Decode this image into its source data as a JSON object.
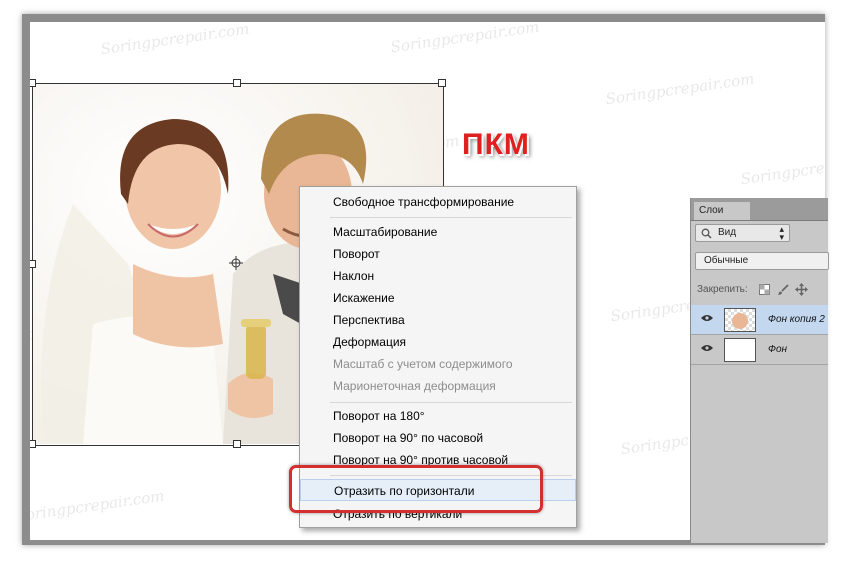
{
  "watermark": "Soringpcrepair.com",
  "annotation": {
    "text": "ПКМ",
    "color": "#e02020"
  },
  "context_menu": {
    "items": [
      {
        "label": "Свободное трансформирование",
        "enabled": true
      },
      {
        "label": "Масштабирование",
        "enabled": true
      },
      {
        "label": "Поворот",
        "enabled": true
      },
      {
        "label": "Наклон",
        "enabled": true
      },
      {
        "label": "Искажение",
        "enabled": true
      },
      {
        "label": "Перспектива",
        "enabled": true
      },
      {
        "label": "Деформация",
        "enabled": true
      },
      {
        "label": "Масштаб с учетом содержимого",
        "enabled": false
      },
      {
        "label": "Марионеточная деформация",
        "enabled": false
      },
      {
        "label": "Поворот на 180°",
        "enabled": true
      },
      {
        "label": "Поворот на 90° по часовой",
        "enabled": true
      },
      {
        "label": "Поворот на 90° против часовой",
        "enabled": true
      },
      {
        "label": "Отразить по горизонтали",
        "enabled": true,
        "highlighted": true
      },
      {
        "label": "Отразить по вертикали",
        "enabled": true
      }
    ],
    "highlight_color": "#d32f2f"
  },
  "layers_panel": {
    "tab_label": "Слои",
    "filter_label": "Вид",
    "blend_mode": "Обычные",
    "lock_label": "Закрепить:",
    "layers": [
      {
        "name": "Фон копия 2",
        "selected": true
      },
      {
        "name": "Фон",
        "selected": false
      }
    ],
    "selected_color": "#c3d7ef"
  }
}
